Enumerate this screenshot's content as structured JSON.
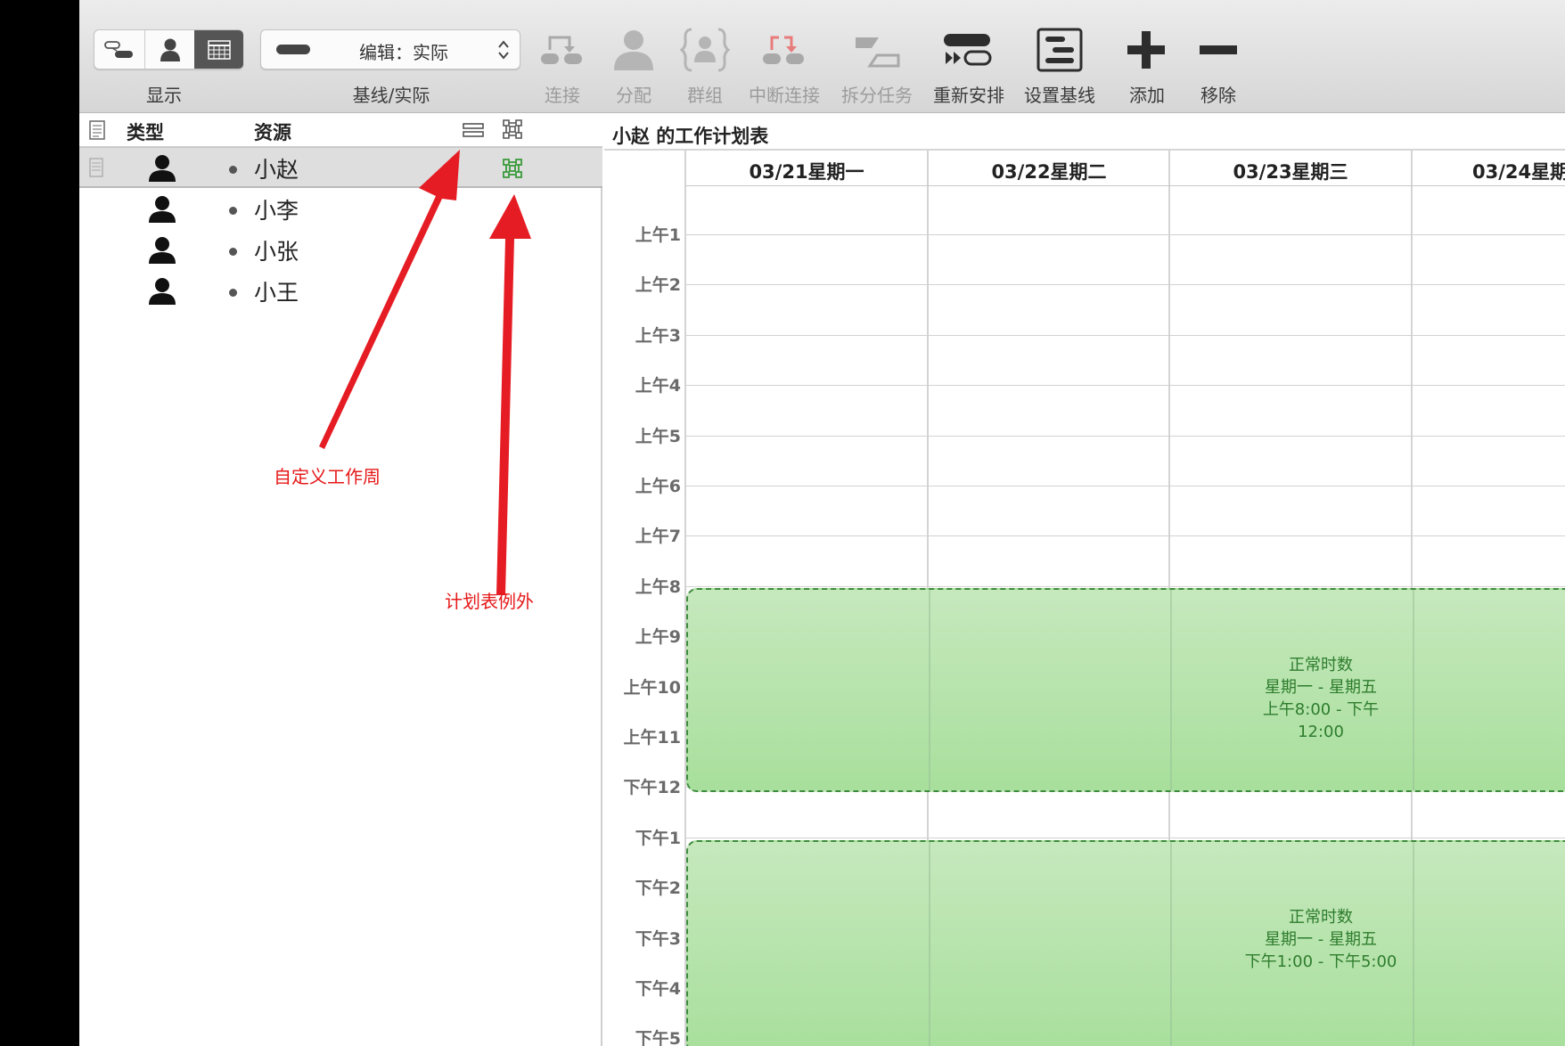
{
  "toolbar": {
    "view_label": "显示",
    "baseline_select_value": "编辑：实际",
    "baseline_label": "基线/实际",
    "buttons": [
      {
        "label": "连接",
        "icon": "link-icon",
        "enabled": false
      },
      {
        "label": "分配",
        "icon": "assign-person-icon",
        "enabled": false
      },
      {
        "label": "群组",
        "icon": "group-icon",
        "enabled": false
      },
      {
        "label": "中断连接",
        "icon": "unlink-icon",
        "enabled": false
      },
      {
        "label": "拆分任务",
        "icon": "split-task-icon",
        "enabled": false
      },
      {
        "label": "重新安排",
        "icon": "reschedule-icon",
        "enabled": true
      },
      {
        "label": "设置基线",
        "icon": "set-baseline-icon",
        "enabled": true
      },
      {
        "label": "添加",
        "icon": "plus-icon",
        "enabled": true
      },
      {
        "label": "移除",
        "icon": "minus-icon",
        "enabled": true
      }
    ]
  },
  "resources": {
    "col_type": "类型",
    "col_resource": "资源",
    "items": [
      {
        "name": "小赵",
        "selected": true
      },
      {
        "name": "小李",
        "selected": false
      },
      {
        "name": "小张",
        "selected": false
      },
      {
        "name": "小王",
        "selected": false
      }
    ]
  },
  "calendar": {
    "title": "小赵 的工作计划表",
    "days": [
      "03/21星期一",
      "03/22星期二",
      "03/23星期三",
      "03/24星期"
    ],
    "hours": [
      "上午1",
      "上午2",
      "上午3",
      "上午4",
      "上午5",
      "上午6",
      "上午7",
      "上午8",
      "上午9",
      "上午10",
      "上午11",
      "下午12",
      "下午1",
      "下午2",
      "下午3",
      "下午4",
      "下午5"
    ],
    "blocks": [
      {
        "title": "正常时数",
        "days": "星期一 - 星期五",
        "time": "上午8:00 - 下午12:00"
      },
      {
        "title": "正常时数",
        "days": "星期一 - 星期五",
        "time": "下午1:00 - 下午5:00"
      }
    ]
  },
  "annotations": {
    "custom_week": "自定义工作周",
    "schedule_exception": "计划表例外"
  },
  "colors": {
    "annotation": "#e61919",
    "work_block": "#a8df9c",
    "work_text": "#2e7d2e"
  }
}
